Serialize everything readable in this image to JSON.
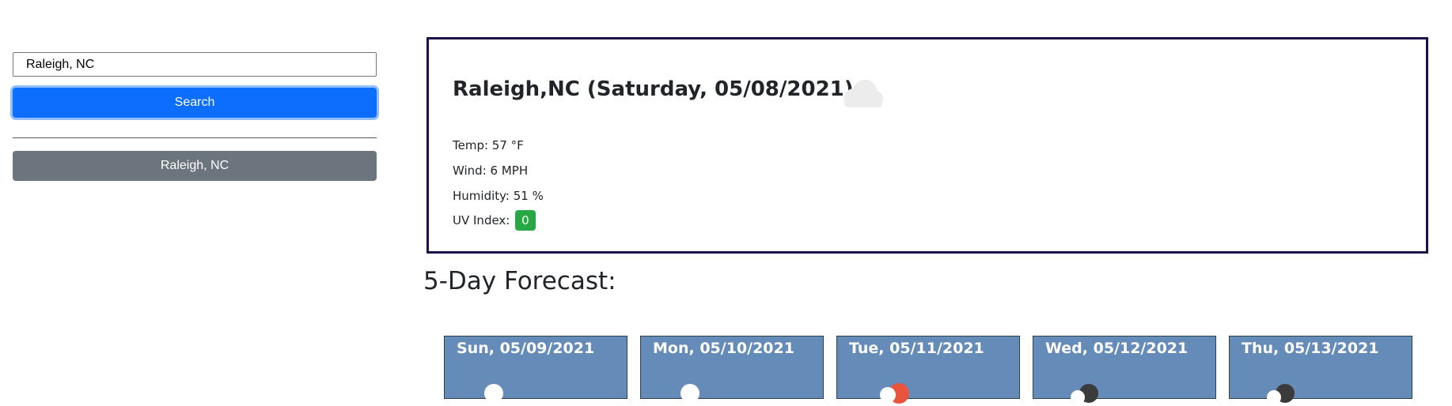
{
  "search": {
    "input_value": "Raleigh, NC",
    "button_label": "Search"
  },
  "history": [
    {
      "label": "Raleigh, NC"
    }
  ],
  "current": {
    "title": "Raleigh,NC (Saturday, 05/08/2021)",
    "icon": "cloud-icon",
    "temp": "Temp: 57 °F",
    "wind": "Wind: 6 MPH",
    "humidity": "Humidity: 51 %",
    "uv_label": "UV Index:",
    "uv_value": "0",
    "uv_color": "#28a745"
  },
  "forecast": {
    "title": "5-Day Forecast:",
    "days": [
      {
        "date": "Sun, 05/09/2021",
        "icon": "partly-cloudy-icon"
      },
      {
        "date": "Mon, 05/10/2021",
        "icon": "partly-cloudy-icon"
      },
      {
        "date": "Tue, 05/11/2021",
        "icon": "sun-cloud-icon"
      },
      {
        "date": "Wed, 05/12/2021",
        "icon": "dark-cloud-icon"
      },
      {
        "date": "Thu, 05/13/2021",
        "icon": "dark-cloud-icon"
      }
    ]
  },
  "colors": {
    "primary": "#0d6efd",
    "secondary": "#6c757d",
    "card_bg": "#658bb8",
    "current_border": "#1e0f4a"
  }
}
